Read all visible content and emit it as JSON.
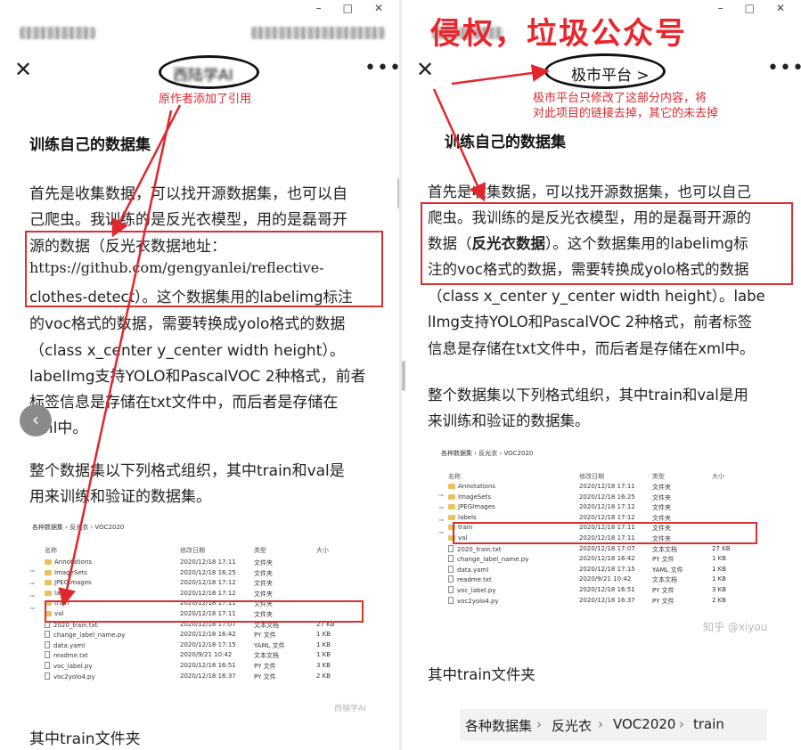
{
  "banner": {
    "title": "侵权，垃圾公众号"
  },
  "window": {
    "minimize": "–",
    "maximize": "□",
    "close": "✕"
  },
  "icons": {
    "close": "close-icon",
    "more": "more-icon",
    "back": "chevron-left-icon",
    "folder": "folder-icon",
    "file": "file-icon"
  },
  "colors": {
    "annotation_red": "#e0272d",
    "accent_blue": "#2d7bdc"
  },
  "left": {
    "account_name": "西陆学AI",
    "note": "原作者添加了引用",
    "heading": "训练自己的数据集",
    "para1": [
      "首先是收集数据，可以找开源数据集，也可以自",
      "己爬虫。我训练的是反光衣模型，用的是磊哥开",
      "源的数据（反光衣数据地址：",
      "https://github.com/gengyanlei/reflective-",
      "clothes-detect）。这个数据集用的labelimg标注",
      "的voc格式的数据，需要转换成yolo格式的数据",
      "（class x_center y_center width height）。",
      "labelImg支持YOLO和PascalVOC 2种格式，前者",
      "标签信息是存储在txt文件中，而后者是存储在",
      "xml中。"
    ],
    "para2": [
      "整个数据集以下列格式组织，其中train和val是",
      "用来训练和验证的数据集。"
    ],
    "para3": "其中train文件夹",
    "watermark": "西柚学AI"
  },
  "right": {
    "account_name": "极市平台 >",
    "note": [
      "极市平台只修改了这部分内容，将",
      "对此项目的链接去掉，其它的未去掉"
    ],
    "heading": "训练自己的数据集",
    "para1": [
      "首先是收集数据，可以找开源数据集，也可以自己",
      "爬虫。我训练的是反光衣模型，用的是磊哥开源的",
      "数据（",
      "反光衣数据",
      "）。这个数据集用的labelimg标",
      "注的voc格式的数据，需要转换成yolo格式的数据",
      "（class x_center y_center width height）。labe",
      "lImg支持YOLO和PascalVOC 2种格式，前者标签",
      "信息是存储在txt文件中，而后者是存储在xml中。"
    ],
    "para2": [
      "整个数据集以下列格式组织，其中train和val是用",
      "来训练和验证的数据集。"
    ],
    "watermark": "知乎 @xiyou",
    "para3": "其中train文件夹",
    "breadcrumb": [
      "各种数据集",
      "›",
      "反光衣",
      "›",
      "VOC2020",
      "›",
      "train"
    ]
  },
  "explorer": {
    "path": "各种数据集  ›  反光衣  ›  VOC2020",
    "headers": [
      "名称",
      "修改日期",
      "类型",
      "大小"
    ],
    "rows": [
      {
        "name": "Annotations",
        "date": "2020/12/18 17:11",
        "type": "文件夹",
        "size": "",
        "kind": "folder"
      },
      {
        "name": "ImageSets",
        "date": "2020/12/18 16:25",
        "type": "文件夹",
        "size": "",
        "kind": "folder"
      },
      {
        "name": "JPEGImages",
        "date": "2020/12/18 17:12",
        "type": "文件夹",
        "size": "",
        "kind": "folder"
      },
      {
        "name": "labels",
        "date": "2020/12/18 17:12",
        "type": "文件夹",
        "size": "",
        "kind": "folder"
      },
      {
        "name": "train",
        "date": "2020/12/18 17:11",
        "type": "文件夹",
        "size": "",
        "kind": "folder"
      },
      {
        "name": "val",
        "date": "2020/12/18 17:11",
        "type": "文件夹",
        "size": "",
        "kind": "folder"
      },
      {
        "name": "2020_train.txt",
        "date": "2020/12/18 17:07",
        "type": "文本文档",
        "size": "27 KB",
        "kind": "file"
      },
      {
        "name": "change_label_name.py",
        "date": "2020/12/18 16:42",
        "type": "PY 文件",
        "size": "1 KB",
        "kind": "file"
      },
      {
        "name": "data.yaml",
        "date": "2020/12/18 17:15",
        "type": "YAML 文件",
        "size": "1 KB",
        "kind": "file"
      },
      {
        "name": "readme.txt",
        "date": "2020/9/21 10:42",
        "type": "文本文档",
        "size": "1 KB",
        "kind": "file"
      },
      {
        "name": "voc_label.py",
        "date": "2020/12/18 16:51",
        "type": "PY 文件",
        "size": "3 KB",
        "kind": "file"
      },
      {
        "name": "voc2yolo4.py",
        "date": "2020/12/18 16:37",
        "type": "PY 文件",
        "size": "2 KB",
        "kind": "file"
      }
    ]
  }
}
